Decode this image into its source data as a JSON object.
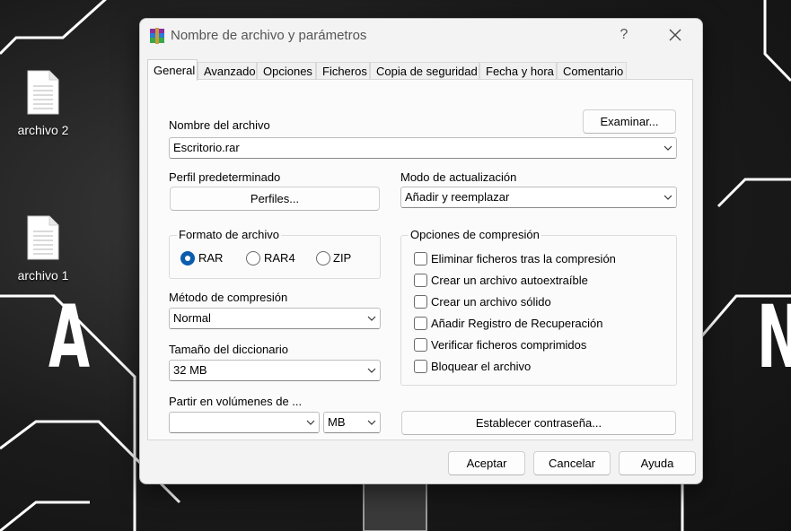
{
  "desktop": {
    "icons": [
      {
        "label": "archivo 2"
      },
      {
        "label": "archivo 1"
      }
    ],
    "letters": {
      "left": "A",
      "right": "N"
    }
  },
  "dialog": {
    "title": "Nombre de archivo y parámetros",
    "help": "?",
    "tabs": [
      {
        "label": "General",
        "active": true
      },
      {
        "label": "Avanzado"
      },
      {
        "label": "Opciones"
      },
      {
        "label": "Ficheros"
      },
      {
        "label": "Copia de seguridad"
      },
      {
        "label": "Fecha y hora"
      },
      {
        "label": "Comentario"
      }
    ],
    "general": {
      "archive_name_label": "Nombre del archivo",
      "browse_button": "Examinar...",
      "archive_name_value": "Escritorio.rar",
      "profile_label": "Perfil predeterminado",
      "profiles_button": "Perfiles...",
      "update_mode_label": "Modo de actualización",
      "update_mode_value": "Añadir y reemplazar",
      "format_group": "Formato de archivo",
      "formats": [
        {
          "label": "RAR",
          "selected": true
        },
        {
          "label": "RAR4",
          "selected": false
        },
        {
          "label": "ZIP",
          "selected": false
        }
      ],
      "method_label": "Método de compresión",
      "method_value": "Normal",
      "dictionary_label": "Tamaño del diccionario",
      "dictionary_value": "32 MB",
      "split_label": "Partir en volúmenes de ...",
      "split_value": "",
      "split_unit": "MB",
      "options_group": "Opciones de compresión",
      "options": [
        {
          "label": "Eliminar ficheros tras la compresión",
          "checked": false
        },
        {
          "label": "Crear un archivo autoextraíble",
          "checked": false
        },
        {
          "label": "Crear un archivo sólido",
          "checked": false
        },
        {
          "label": "Añadir Registro de Recuperación",
          "checked": false
        },
        {
          "label": "Verificar ficheros comprimidos",
          "checked": false
        },
        {
          "label": "Bloquear el archivo",
          "checked": false
        }
      ],
      "password_button": "Establecer contraseña..."
    },
    "footer": {
      "ok": "Aceptar",
      "cancel": "Cancelar",
      "help": "Ayuda"
    }
  },
  "colors": {
    "accent": "#0b5cad",
    "dialog_bg": "#f3f3f3",
    "panel_bg": "#fbfbfb"
  }
}
